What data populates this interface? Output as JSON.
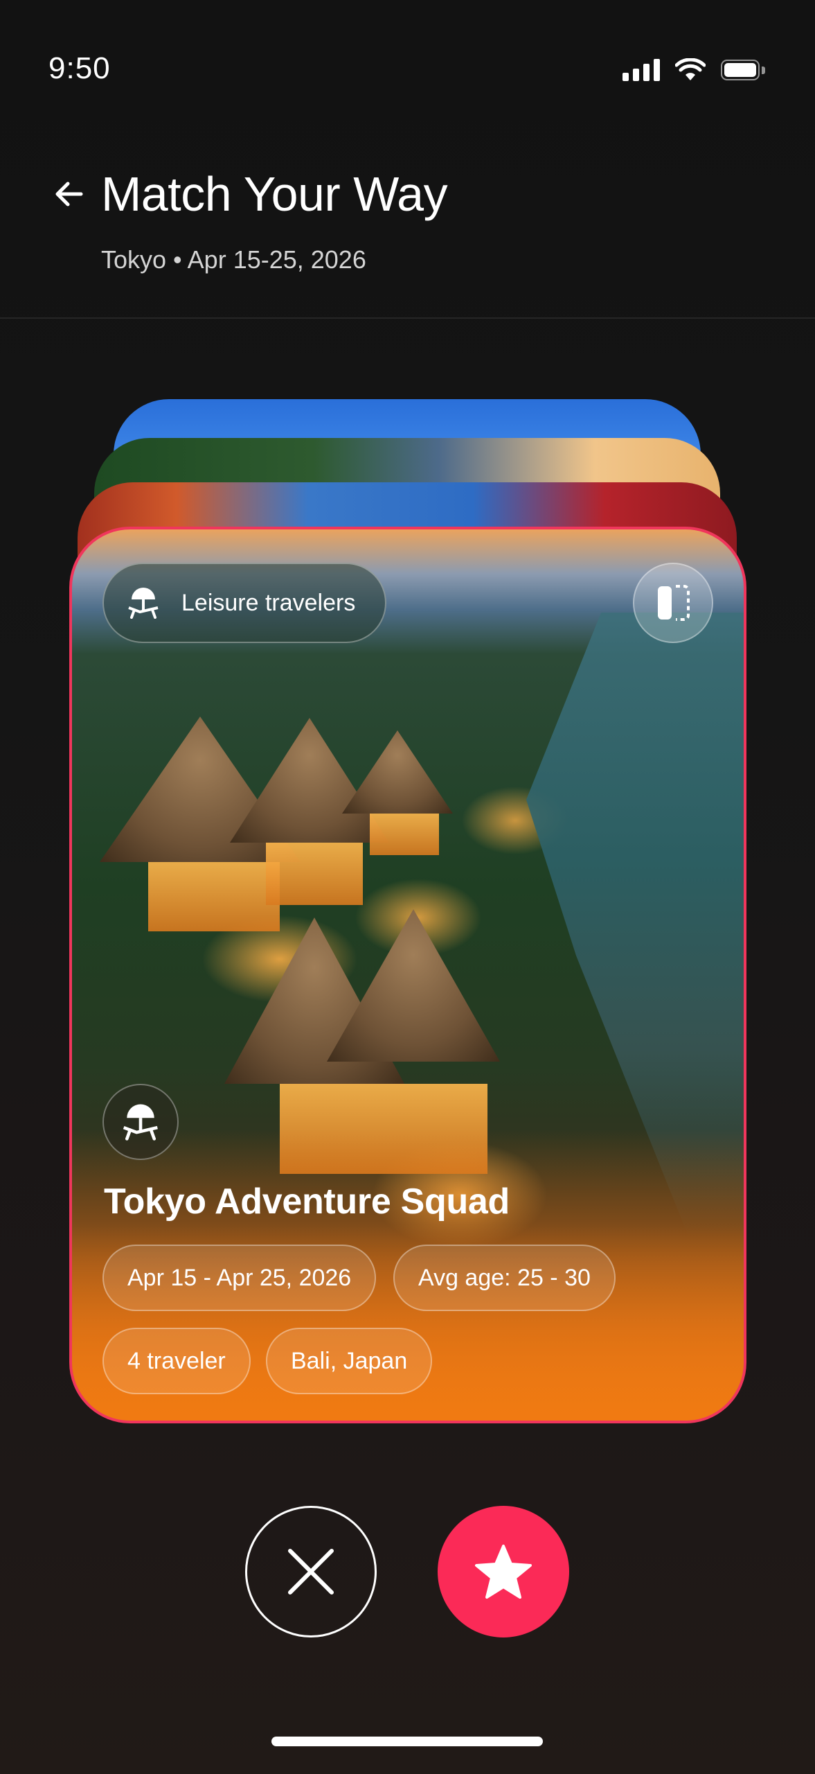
{
  "status_bar": {
    "time": "9:50",
    "icons": [
      "cellular-signal-icon",
      "wifi-icon",
      "battery-icon"
    ]
  },
  "header": {
    "back_icon": "arrow-left-icon",
    "title": "Match Your Way",
    "subtitle": "Tokyo • Apr 15-25, 2026"
  },
  "card": {
    "badge_icon": "beach-umbrella-icon",
    "badge_label": "Leisure travelers",
    "compare_icon": "compare-split-icon",
    "category_icon": "beach-umbrella-icon",
    "title": "Tokyo Adventure Squad",
    "tags": {
      "dates": "Apr 15 - Apr 25, 2026",
      "age": "Avg age: 25 - 30",
      "travelers": "4 traveler",
      "location": "Bali, Japan"
    }
  },
  "actions": {
    "reject_icon": "close-x-icon",
    "like_icon": "star-icon",
    "like_color": "#fb2a57"
  },
  "colors": {
    "background": "#141414",
    "card_border": "#f0365c",
    "card_bottom": "#f07a12"
  }
}
